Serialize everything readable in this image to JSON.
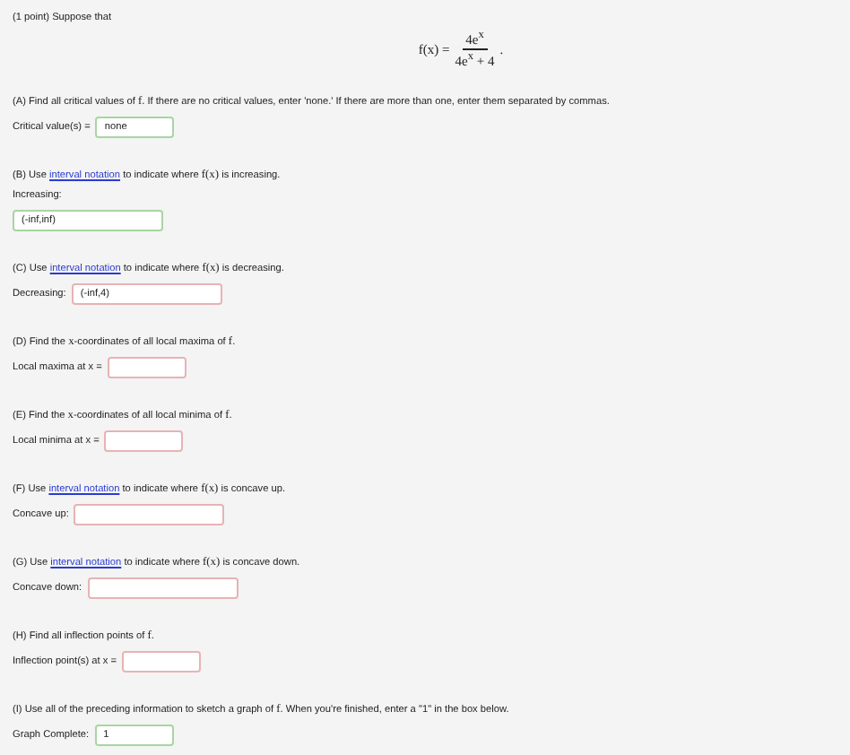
{
  "intro": "(1 point) Suppose that",
  "formula": {
    "lhs": "f(x) =",
    "numerator": "4e$^{x}$",
    "denominator": "4e$^{x}$ + 4",
    "tail": "."
  },
  "parts": [
    {
      "prompt": [
        {
          "kind": "text",
          "text": "(A) Find all critical values of "
        },
        {
          "kind": "math",
          "text": "f"
        },
        {
          "kind": "text",
          "text": ". If there are no critical values, enter 'none.' If there are more than one, enter them separated by commas."
        }
      ],
      "label": "Critical value(s) =",
      "kind": "inline",
      "answer": {
        "kind": "value",
        "value": "none",
        "correct": true
      }
    },
    {
      "prompt": [
        {
          "kind": "text",
          "text": "(B) Use "
        },
        {
          "kind": "link",
          "text": "interval notation"
        },
        {
          "kind": "text",
          "text": " to indicate where "
        },
        {
          "kind": "math",
          "text": "f(x)"
        },
        {
          "kind": "text",
          "text": " is increasing."
        }
      ],
      "label": "Increasing:",
      "kind": "stacked",
      "answer": {
        "kind": "interval",
        "value": "(-inf,inf)",
        "correct": true
      }
    },
    {
      "prompt": [
        {
          "kind": "text",
          "text": "(C) Use "
        },
        {
          "kind": "link",
          "text": "interval notation"
        },
        {
          "kind": "text",
          "text": " to indicate where "
        },
        {
          "kind": "math",
          "text": "f(x)"
        },
        {
          "kind": "text",
          "text": " is decreasing."
        }
      ],
      "label": "Decreasing:",
      "kind": "inline",
      "answer": {
        "kind": "interval",
        "value": "(-inf,4)",
        "correct": false
      }
    },
    {
      "prompt": [
        {
          "kind": "text",
          "text": "(D) Find the "
        },
        {
          "kind": "math",
          "text": "x"
        },
        {
          "kind": "text",
          "text": "-coordinates of all local maxima of "
        },
        {
          "kind": "math",
          "text": "f"
        },
        {
          "kind": "text",
          "text": "."
        }
      ],
      "label": "Local maxima at x =",
      "kind": "inline",
      "answer": {
        "kind": "value",
        "correct": false
      }
    },
    {
      "prompt": [
        {
          "kind": "text",
          "text": "(E) Find the "
        },
        {
          "kind": "math",
          "text": "x"
        },
        {
          "kind": "text",
          "text": "-coordinates of all local minima of "
        },
        {
          "kind": "math",
          "text": "f"
        },
        {
          "kind": "text",
          "text": "."
        }
      ],
      "label": "Local minima at x =",
      "kind": "inline",
      "answer": {
        "kind": "value",
        "correct": false
      }
    },
    {
      "prompt": [
        {
          "kind": "text",
          "text": "(F) Use "
        },
        {
          "kind": "link",
          "text": "interval notation"
        },
        {
          "kind": "text",
          "text": " to indicate where "
        },
        {
          "kind": "math",
          "text": "f(x)"
        },
        {
          "kind": "text",
          "text": " is concave up."
        }
      ],
      "label": "Concave up:",
      "kind": "inline",
      "answer": {
        "kind": "interval",
        "correct": false
      }
    },
    {
      "prompt": [
        {
          "kind": "text",
          "text": "(G) Use "
        },
        {
          "kind": "link",
          "text": "interval notation"
        },
        {
          "kind": "text",
          "text": " to indicate where "
        },
        {
          "kind": "math",
          "text": "f(x)"
        },
        {
          "kind": "text",
          "text": " is concave down."
        }
      ],
      "label": "Concave down:",
      "kind": "inline",
      "answer": {
        "kind": "interval",
        "correct": false
      }
    },
    {
      "prompt": [
        {
          "kind": "text",
          "text": "(H) Find all inflection points of "
        },
        {
          "kind": "math",
          "text": "f"
        },
        {
          "kind": "text",
          "text": "."
        }
      ],
      "label": "Inflection point(s) at x =",
      "kind": "inline",
      "answer": {
        "kind": "value",
        "correct": false
      }
    },
    {
      "prompt": [
        {
          "kind": "text",
          "text": "(I) Use all of the preceding information to sketch a graph of "
        },
        {
          "kind": "math",
          "text": "f"
        },
        {
          "kind": "text",
          "text": ". When you're finished, enter a \"1\" in the box below."
        }
      ],
      "label": "Graph Complete:",
      "kind": "inline",
      "answer": {
        "kind": "value",
        "value": "1",
        "correct": true
      }
    }
  ]
}
